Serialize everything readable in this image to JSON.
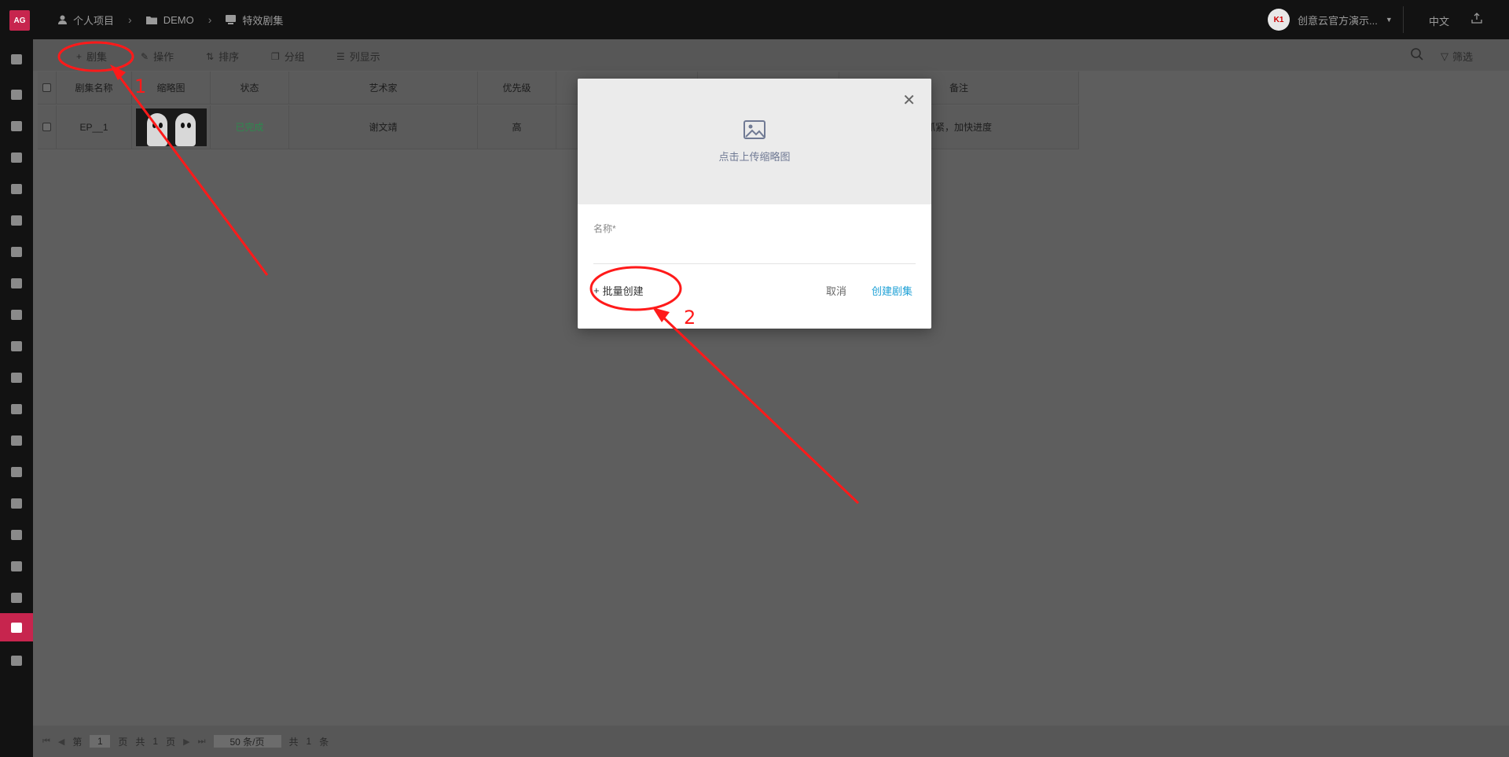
{
  "app": {
    "logo": "AG"
  },
  "breadcrumbs": [
    {
      "label": "个人项目",
      "icon": "user-icon"
    },
    {
      "label": "DEMO",
      "icon": "folder-icon"
    },
    {
      "label": "特效剧集",
      "icon": "episode-icon"
    }
  ],
  "user": {
    "name": "创意云官方演示...",
    "avatar": "K1"
  },
  "language": "中文",
  "toolbar": {
    "add_label": "剧集",
    "operate_label": "操作",
    "sort_label": "排序",
    "group_label": "分组",
    "columns_label": "列显示",
    "filter_label": "筛选"
  },
  "table": {
    "headers": {
      "name": "剧集名称",
      "thumbnail": "缩略图",
      "status": "状态",
      "artist": "艺术家",
      "priority": "优先级",
      "note": "备注"
    },
    "rows": [
      {
        "name": "EP__1",
        "status": "已完成",
        "artist": "谢文靖",
        "priority": "高",
        "note": "抓紧，加快进度"
      }
    ]
  },
  "pagination": {
    "page_prefix": "第",
    "page": "1",
    "page_suffix": "页",
    "total_pages_prefix": "共",
    "total_pages": "1",
    "total_pages_suffix": "页",
    "page_size": "50 条/页",
    "total_prefix": "共",
    "total": "1",
    "total_suffix": "条"
  },
  "modal": {
    "upload_text": "点击上传缩略图",
    "name_label": "名称*",
    "name_value": "",
    "batch_create_label": "批量创建",
    "cancel_label": "取消",
    "create_label": "创建剧集"
  },
  "annotations": {
    "step1": "1",
    "step2": "2",
    "color": "#ff1a1a"
  }
}
